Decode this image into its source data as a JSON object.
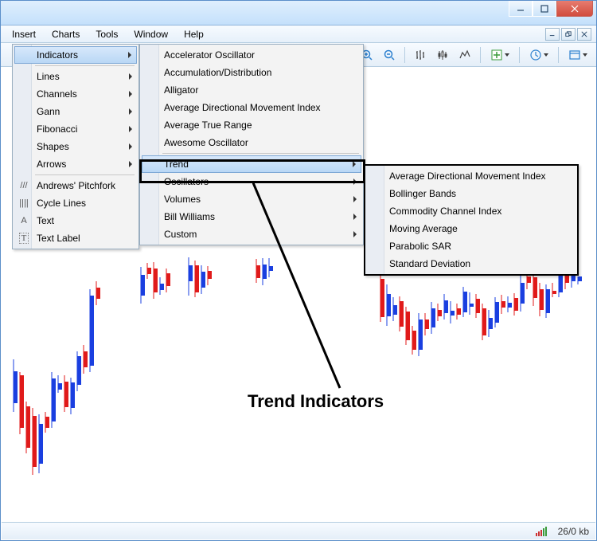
{
  "menubar": {
    "items": [
      "Insert",
      "Charts",
      "Tools",
      "Window",
      "Help"
    ]
  },
  "insert_menu": {
    "indicators": "Indicators",
    "lines": "Lines",
    "channels": "Channels",
    "gann": "Gann",
    "fibonacci": "Fibonacci",
    "shapes": "Shapes",
    "arrows": "Arrows",
    "andrews": "Andrews' Pitchfork",
    "cycle": "Cycle Lines",
    "text": "Text",
    "textlabel": "Text Label"
  },
  "indicators_menu": {
    "accelerator": "Accelerator Oscillator",
    "accum": "Accumulation/Distribution",
    "alligator": "Alligator",
    "admi": "Average Directional Movement Index",
    "atr": "Average True Range",
    "awesome": "Awesome Oscillator",
    "trend": "Trend",
    "oscillators": "Oscillators",
    "volumes": "Volumes",
    "bill": "Bill Williams",
    "custom": "Custom"
  },
  "trend_menu": {
    "admi": "Average Directional Movement Index",
    "bollinger": "Bollinger Bands",
    "cci": "Commodity Channel Index",
    "ma": "Moving Average",
    "psar": "Parabolic SAR",
    "stdev": "Standard Deviation"
  },
  "annotation": "Trend Indicators",
  "status": {
    "kb": "26/0 kb"
  },
  "icons": {
    "andrews": "///",
    "cycle": "||||",
    "text": "A",
    "textlabel": "T"
  }
}
